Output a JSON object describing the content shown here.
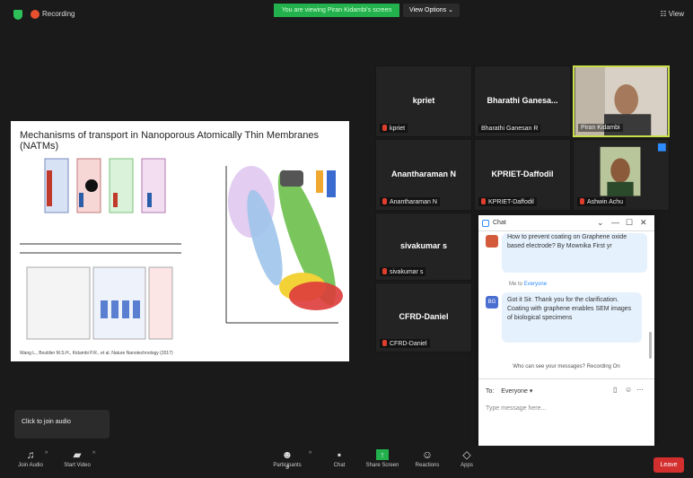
{
  "top": {
    "recording": "Recording",
    "banner": "You are viewing Piran Kidambi's screen",
    "view_options": "View Options ⌄",
    "view": "☷ View"
  },
  "slide": {
    "title": "Mechanisms of transport in Nanoporous Atomically Thin Membranes (NATMs)",
    "citation": "Wang L., Boutilier M.S.H., Kidambi P.R., et al. Nature Nanotechnology (2017)"
  },
  "tiles": [
    {
      "name": "kpriet",
      "label": "kpriet"
    },
    {
      "name": "Bharathi Ganesa...",
      "label": "Bharathi Ganesan R"
    },
    {
      "name": "",
      "label": "Piran Kidambi"
    },
    {
      "name": "Anantharaman N",
      "label": "Anantharaman N"
    },
    {
      "name": "KPRIET-Daffodil",
      "label": "KPRIET-Daffodil"
    },
    {
      "name": "",
      "label": "Ashwin Achu"
    },
    {
      "name": "sivakumar s",
      "label": "sivakumar s"
    },
    {
      "name": "CFRD-Daniel",
      "label": "CFRD-Daniel"
    }
  ],
  "chat": {
    "title": "Chat",
    "msg1": "How to prevent coating on Graphene oxide based electrode? By Mownika First yr",
    "me_to": "Me to",
    "everyone": "Everyone",
    "msg2": "Got it Sir. Thank you for the clarification. Coating with graphene enables SEM images of biological specimens",
    "avatar": "BG",
    "who_see": "Who can see your messages? Recording On",
    "to": "To:",
    "to_value": "Everyone ▾",
    "placeholder": "Type message here..."
  },
  "toolbar": {
    "join_audio": "Join Audio",
    "start_video": "Start Video",
    "participants": "Participants",
    "participants_count": "8",
    "chat": "Chat",
    "share_screen": "Share Screen",
    "reactions": "Reactions",
    "apps": "Apps",
    "leave": "Leave"
  },
  "join_audio_tip": "Click to join audio",
  "colors": {
    "banner": "#23b14d",
    "leave": "#d32f2f",
    "accent": "#2d8cff"
  }
}
